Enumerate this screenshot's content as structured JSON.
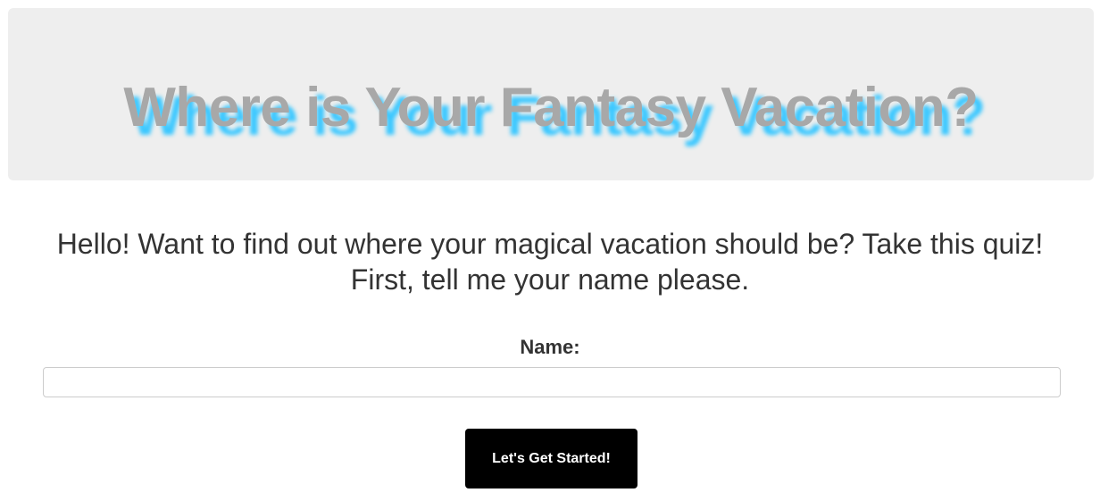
{
  "header": {
    "title": "Where is Your Fantasy Vacation?"
  },
  "intro": {
    "text": "Hello! Want to find out where your magical vacation should be? Take this quiz! First, tell me your name please."
  },
  "form": {
    "name_label": "Name:",
    "name_value": "",
    "submit_label": "Let's Get Started!"
  },
  "colors": {
    "title": "#a8a8a8",
    "title_shadow": "#3cc8ff",
    "button_bg": "#000000"
  }
}
